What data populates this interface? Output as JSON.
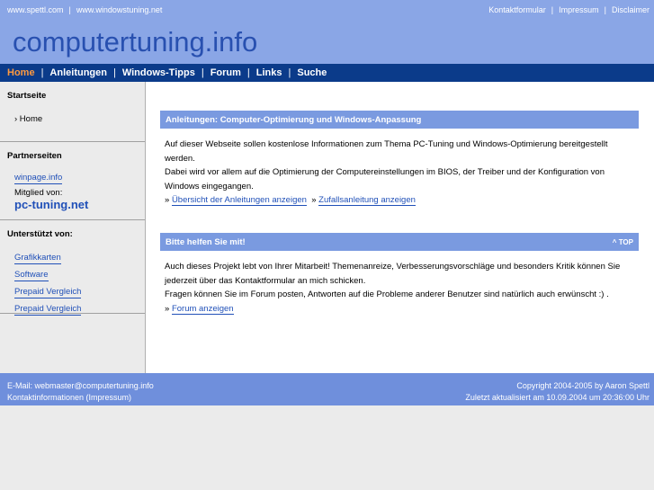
{
  "topbar": {
    "links_left": [
      "www.spettl.com",
      "www.windowstuning.net"
    ],
    "links_right": [
      "Kontaktformular",
      "Impressum",
      "Disclaimer"
    ],
    "separator": "|"
  },
  "site_title": "computertuning.info",
  "nav": {
    "items": [
      "Home",
      "Anleitungen",
      "Windows-Tipps",
      "Forum",
      "Links",
      "Suche"
    ],
    "separator": "|"
  },
  "sidebar": {
    "startseite": {
      "heading": "Startseite",
      "item": "› Home"
    },
    "partner": {
      "heading": "Partnerseiten",
      "link1": "winpage.info",
      "member_text": "Mitglied von:",
      "link2": "pc-tuning.net"
    },
    "support": {
      "heading": "Unterstützt von:",
      "links": [
        "Grafikkarten",
        "Software",
        "Prepaid Vergleich",
        "Prepaid Vergleich"
      ]
    }
  },
  "main": {
    "box1": {
      "title": "Anleitungen: Computer-Optimierung und Windows-Anpassung",
      "line1": "Auf dieser Webseite sollen kostenlose Informationen zum Thema PC-Tuning und Windows-Optimierung bereitgestellt werden.",
      "line2": "Dabei wird vor allem auf die Optimierung der Computereinstellungen im BIOS, der Treiber und der Konfiguration von Windows eingegangen.",
      "arrow": "»",
      "link1": "Übersicht der Anleitungen anzeigen",
      "link2": "Zufallsanleitung anzeigen"
    },
    "box2": {
      "title": "Bitte helfen Sie mit!",
      "top_link": "^ TOP",
      "line1": "Auch dieses Projekt lebt von Ihrer Mitarbeit! Themenanreize, Verbesserungsvorschläge und besonders Kritik können Sie jederzeit über das Kontaktformular an mich schicken.",
      "line2": "Fragen können Sie im Forum posten, Antworten auf die Probleme anderer Benutzer sind natürlich auch erwünscht :) .",
      "arrow": "»",
      "link": "Forum anzeigen"
    }
  },
  "footer": {
    "email_label": "E-Mail:",
    "email": "webmaster@computertuning.info",
    "contact": "Kontaktinformationen (Impressum)",
    "copyright": "Copyright 2004-2005 by Aaron Spettl",
    "updated": "Zuletzt aktualisiert am 10.09.2004 um 20:36:00 Uhr"
  },
  "colors": {
    "header_bg": "#8aa6e6",
    "nav_bg": "#0b3b8a",
    "nav_active": "#ff9a40",
    "box_head_bg": "#7a9ae0",
    "link": "#2050b8",
    "footer_bg": "#6f8fdc"
  }
}
